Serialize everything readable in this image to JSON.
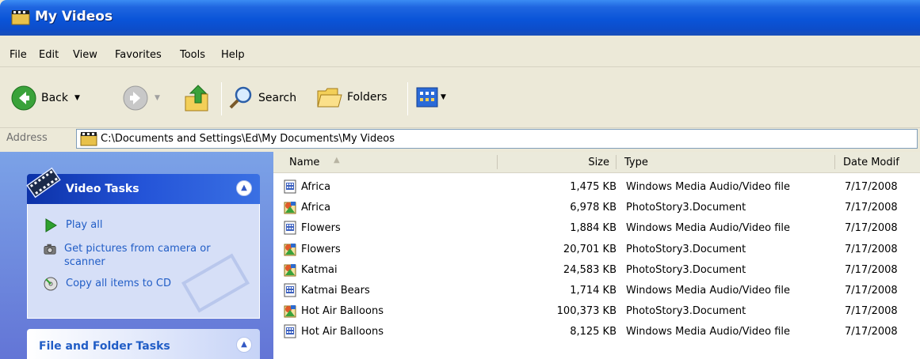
{
  "window": {
    "title": "My Videos"
  },
  "menu": [
    "File",
    "Edit",
    "View",
    "Favorites",
    "Tools",
    "Help"
  ],
  "toolbar": {
    "back_label": "Back",
    "search_label": "Search",
    "folders_label": "Folders"
  },
  "address": {
    "label": "Address",
    "path": "C:\\Documents and Settings\\Ed\\My Documents\\My Videos"
  },
  "tasks": {
    "video": {
      "title": "Video Tasks",
      "items": [
        "Play all",
        "Get pictures from camera or scanner",
        "Copy all items to CD"
      ]
    },
    "file_folder": {
      "title": "File and Folder Tasks"
    }
  },
  "columns": {
    "name": "Name",
    "size": "Size",
    "type": "Type",
    "date": "Date Modif"
  },
  "files": [
    {
      "name": "Africa",
      "size": "1,475 KB",
      "type": "Windows Media Audio/Video file",
      "date": "7/17/2008",
      "icon": "wmv-file-icon"
    },
    {
      "name": "Africa",
      "size": "6,978 KB",
      "type": "PhotoStory3.Document",
      "date": "7/17/2008",
      "icon": "photostory-file-icon"
    },
    {
      "name": "Flowers",
      "size": "1,884 KB",
      "type": "Windows Media Audio/Video file",
      "date": "7/17/2008",
      "icon": "wmv-file-icon"
    },
    {
      "name": "Flowers",
      "size": "20,701 KB",
      "type": "PhotoStory3.Document",
      "date": "7/17/2008",
      "icon": "photostory-file-icon"
    },
    {
      "name": "Katmai",
      "size": "24,583 KB",
      "type": "PhotoStory3.Document",
      "date": "7/17/2008",
      "icon": "photostory-file-icon"
    },
    {
      "name": "Katmai Bears",
      "size": "1,714 KB",
      "type": "Windows Media Audio/Video file",
      "date": "7/17/2008",
      "icon": "wmv-file-icon"
    },
    {
      "name": "Hot Air Balloons",
      "size": "100,373 KB",
      "type": "PhotoStory3.Document",
      "date": "7/17/2008",
      "icon": "photostory-file-icon"
    },
    {
      "name": "Hot Air Balloons",
      "size": "8,125 KB",
      "type": "Windows Media Audio/Video file",
      "date": "7/17/2008",
      "icon": "wmv-file-icon"
    }
  ],
  "colors": {
    "title_bar": "#0a54d8",
    "task_pane": "#6e8ee0",
    "task_link": "#215dc6",
    "panel_header": "#2454d8"
  }
}
